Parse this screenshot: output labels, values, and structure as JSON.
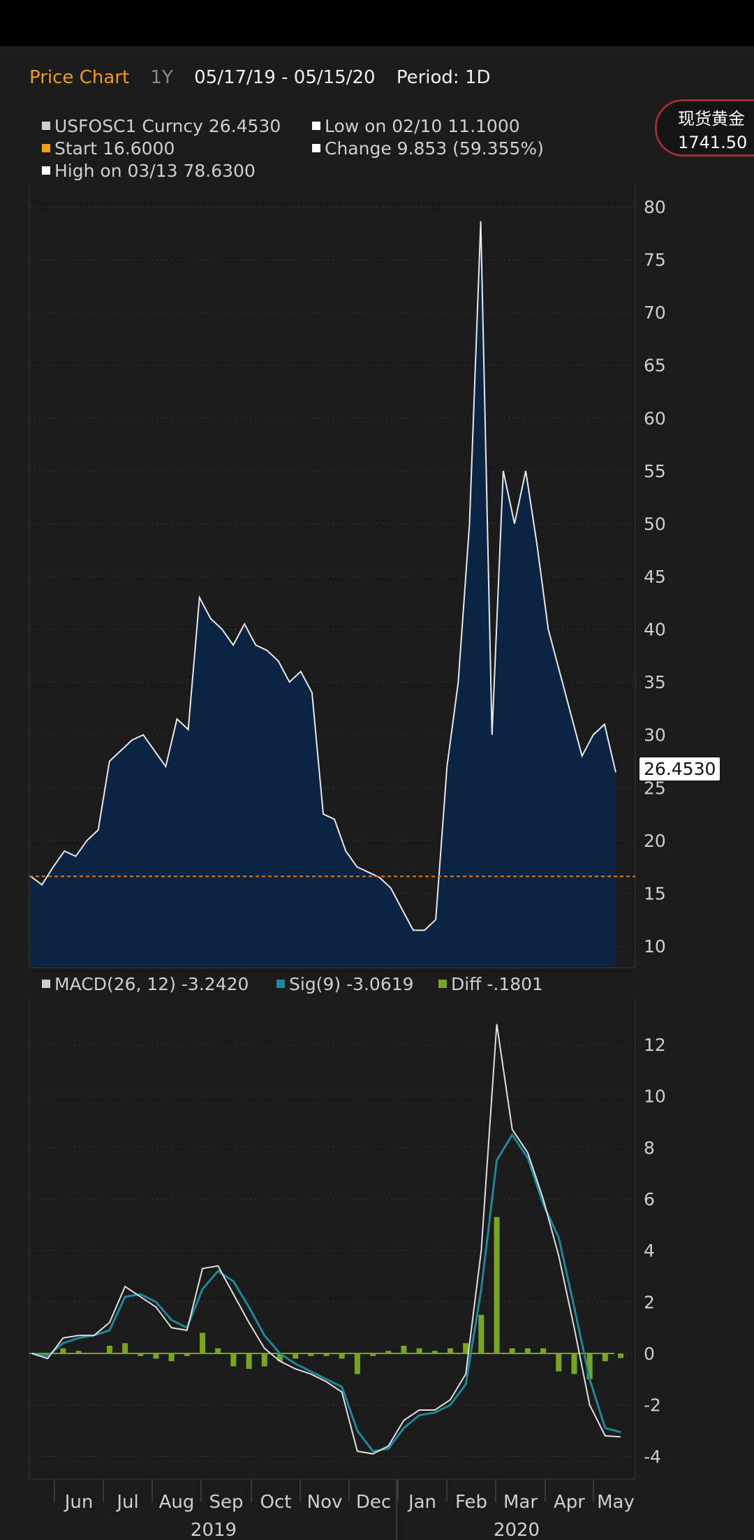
{
  "header": {
    "title": "Price Chart",
    "range": "1Y",
    "dates": "05/17/19 - 05/15/20",
    "period": "Period: 1D"
  },
  "legend_top": {
    "item1": "USFOSC1 Curncy 26.4530",
    "item2": "Start 16.6000",
    "item3": "High on 03/13 78.6300",
    "item4": "Low on 02/10 11.1000",
    "item5": "Change 9.853 (59.355%)"
  },
  "ticker": {
    "name": "现货黄金",
    "price": "1741.50"
  },
  "last_price_tag": "26.4530",
  "legend_bottom": {
    "macd": "MACD(26, 12) -3.2420",
    "sig": "Sig(9) -3.0619",
    "diff": "Diff -.1801"
  },
  "colors": {
    "accent": "#f39c12",
    "area": "#0c2444",
    "line": "#e8e8e8",
    "sig": "#1a8a9a",
    "diff": "#7aa61c",
    "start": "#e07b1a"
  },
  "chart_data": [
    {
      "type": "area",
      "series": [
        {
          "name": "USFOSC1 Curncy"
        }
      ],
      "x": [
        "05/17/19",
        "05/24/19",
        "05/31/19",
        "06/07/19",
        "06/14/19",
        "06/21/19",
        "06/28/19",
        "07/05/19",
        "07/12/19",
        "07/19/19",
        "07/26/19",
        "08/02/19",
        "08/09/19",
        "08/16/19",
        "08/23/19",
        "08/30/19",
        "09/06/19",
        "09/13/19",
        "09/20/19",
        "09/27/19",
        "10/04/19",
        "10/11/19",
        "10/18/19",
        "10/25/19",
        "11/01/19",
        "11/08/19",
        "11/15/19",
        "11/22/19",
        "11/29/19",
        "12/06/19",
        "12/13/19",
        "12/20/19",
        "12/27/19",
        "01/03/20",
        "01/10/20",
        "01/17/20",
        "01/24/20",
        "01/31/20",
        "02/07/20",
        "02/14/20",
        "02/21/20",
        "02/28/20",
        "03/06/20",
        "03/13/20",
        "03/20/20",
        "03/27/20",
        "04/03/20",
        "04/10/20",
        "04/17/20",
        "04/24/20",
        "05/01/20",
        "05/08/20",
        "05/15/20"
      ],
      "values": [
        16.6,
        15.8,
        17.5,
        19.0,
        18.5,
        20.0,
        21.0,
        27.5,
        28.5,
        29.5,
        30.0,
        28.5,
        27.0,
        31.5,
        30.5,
        43.0,
        41.0,
        40.0,
        38.5,
        40.5,
        38.5,
        38.0,
        37.0,
        35.0,
        36.0,
        34.0,
        22.5,
        22.0,
        19.0,
        17.5,
        17.0,
        16.5,
        15.5,
        13.5,
        11.5,
        11.5,
        12.5,
        27.0,
        35.0,
        50.0,
        78.63,
        30.0,
        55.0,
        50.0,
        55.0,
        48.0,
        40.0,
        36.0,
        32.0,
        28.0,
        30.0,
        31.0,
        26.453
      ],
      "ylim": [
        8,
        81
      ],
      "yticks": [
        10,
        15,
        20,
        25,
        30,
        35,
        40,
        45,
        50,
        55,
        60,
        65,
        70,
        75,
        80
      ],
      "start_value": 16.6
    },
    {
      "type": "line",
      "series": [
        {
          "name": "MACD(26, 12)",
          "values": [
            0,
            -0.2,
            0.6,
            0.7,
            0.7,
            1.2,
            2.6,
            2.2,
            1.8,
            1.0,
            0.9,
            3.3,
            3.4,
            2.3,
            1.2,
            0.2,
            -0.3,
            -0.6,
            -0.8,
            -1.1,
            -1.5,
            -3.8,
            -3.9,
            -3.6,
            -2.6,
            -2.2,
            -2.2,
            -1.8,
            -0.8,
            4.0,
            12.8,
            8.7,
            7.8,
            6.0,
            3.8,
            1.0,
            -2.0,
            -3.2,
            -3.24
          ]
        },
        {
          "name": "Sig(9)",
          "values": [
            0,
            -0.1,
            0.4,
            0.6,
            0.7,
            0.9,
            2.2,
            2.3,
            2.0,
            1.3,
            1.0,
            2.5,
            3.2,
            2.8,
            1.8,
            0.7,
            0.0,
            -0.4,
            -0.7,
            -1.0,
            -1.3,
            -3.0,
            -3.8,
            -3.7,
            -2.9,
            -2.4,
            -2.3,
            -2.0,
            -1.2,
            2.5,
            7.5,
            8.5,
            7.6,
            5.8,
            4.5,
            1.8,
            -1.0,
            -2.9,
            -3.06
          ]
        },
        {
          "name": "Diff",
          "values": [
            0,
            -0.1,
            0.2,
            0.1,
            0.0,
            0.3,
            0.4,
            -0.1,
            -0.2,
            -0.3,
            -0.1,
            0.8,
            0.2,
            -0.5,
            -0.6,
            -0.5,
            -0.3,
            -0.2,
            -0.1,
            -0.1,
            -0.2,
            -0.8,
            -0.1,
            0.1,
            0.3,
            0.2,
            0.1,
            0.2,
            0.4,
            1.5,
            5.3,
            0.2,
            0.2,
            0.2,
            -0.7,
            -0.8,
            -1.0,
            -0.3,
            -0.18
          ]
        }
      ],
      "ylim": [
        -4.5,
        13
      ],
      "yticks": [
        -4,
        -2,
        0,
        2,
        4,
        6,
        8,
        10,
        12
      ]
    }
  ],
  "x_axis": {
    "months": [
      "Jun",
      "Jul",
      "Aug",
      "Sep",
      "Oct",
      "Nov",
      "Dec",
      "Jan",
      "Feb",
      "Mar",
      "Apr",
      "May"
    ],
    "years": [
      "2019",
      "2020"
    ]
  }
}
